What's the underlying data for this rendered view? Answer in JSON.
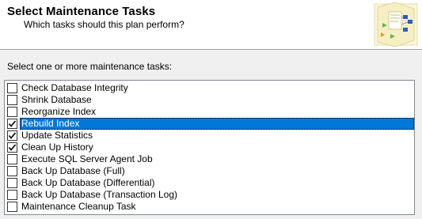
{
  "header": {
    "title": "Select Maintenance Tasks",
    "subtitle": "Which tasks should this plan perform?",
    "graphic_icon": "wizard-flowchart-icon"
  },
  "section_label": "Select one or more maintenance tasks:",
  "tasks": [
    {
      "label": "Check Database Integrity",
      "checked": false,
      "selected": false
    },
    {
      "label": "Shrink Database",
      "checked": false,
      "selected": false
    },
    {
      "label": "Reorganize Index",
      "checked": false,
      "selected": false
    },
    {
      "label": "Rebuild Index",
      "checked": true,
      "selected": true
    },
    {
      "label": "Update Statistics",
      "checked": true,
      "selected": false
    },
    {
      "label": "Clean Up History",
      "checked": true,
      "selected": false
    },
    {
      "label": "Execute SQL Server Agent Job",
      "checked": false,
      "selected": false
    },
    {
      "label": "Back Up Database (Full)",
      "checked": false,
      "selected": false
    },
    {
      "label": "Back Up Database (Differential)",
      "checked": false,
      "selected": false
    },
    {
      "label": "Back Up Database (Transaction Log)",
      "checked": false,
      "selected": false
    },
    {
      "label": "Maintenance Cleanup Task",
      "checked": false,
      "selected": false
    }
  ],
  "colors": {
    "selection": "#0078d7",
    "header_bg": "#ffffff",
    "dialog_bg": "#f0f0f0"
  }
}
